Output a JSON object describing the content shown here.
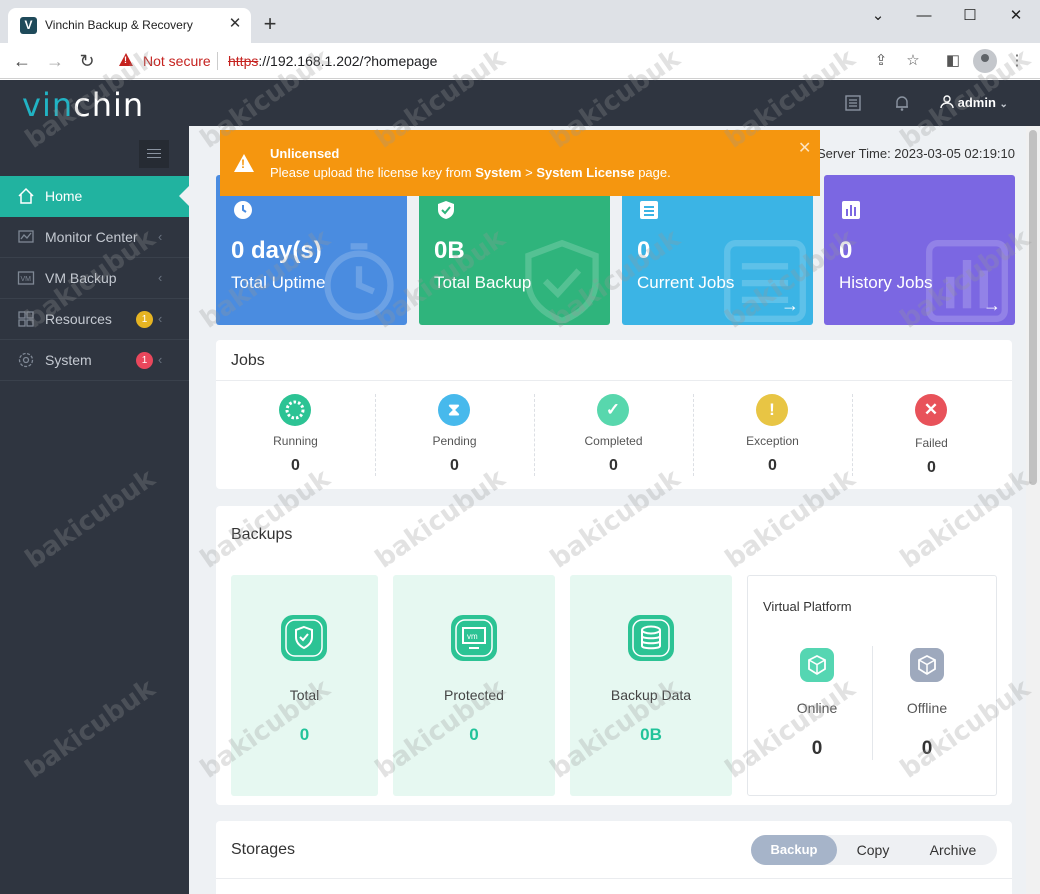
{
  "browser": {
    "tab_title": "Vinchin Backup & Recovery",
    "favicon_letter": "V",
    "security_label": "Not secure",
    "url_scheme": "https",
    "url_rest": "://192.168.1.202/?homepage"
  },
  "header": {
    "logo_accent": "vin",
    "logo_rest": "chin",
    "user": "admin"
  },
  "sidebar": {
    "items": [
      {
        "label": "Home",
        "icon": "home-icon",
        "active": true
      },
      {
        "label": "Monitor Center",
        "icon": "monitor-icon"
      },
      {
        "label": "VM Backup",
        "icon": "vm-icon"
      },
      {
        "label": "Resources",
        "icon": "resources-icon",
        "badge": "1",
        "badge_color": "#e6b422"
      },
      {
        "label": "System",
        "icon": "gear-icon",
        "badge": "1",
        "badge_color": "#e9475c"
      }
    ]
  },
  "banner": {
    "title": "Unlicensed",
    "msg_prefix": "Please upload the license key from ",
    "msg_path_1": "System",
    "msg_arrow": " > ",
    "msg_path_2": "System License",
    "msg_suffix": " page."
  },
  "server_time": "Server Time: 2023-03-05 02:19:10",
  "stats": [
    {
      "value": "0 day(s)",
      "label": "Total Uptime",
      "color": "#4a8ce0",
      "icon": "clock-icon"
    },
    {
      "value": "0B",
      "label": "Total Backup",
      "color": "#2fb47c",
      "icon": "shield-icon"
    },
    {
      "value": "0",
      "label": "Current Jobs",
      "color": "#3bb4e5",
      "icon": "list-icon"
    },
    {
      "value": "0",
      "label": "History Jobs",
      "color": "#7b67e2",
      "icon": "bar-chart-icon"
    }
  ],
  "jobs": {
    "title": "Jobs",
    "items": [
      {
        "label": "Running",
        "value": "0",
        "color": "#2cc394",
        "icon": "spinner-icon"
      },
      {
        "label": "Pending",
        "value": "0",
        "color": "#47b9ec",
        "icon": "hourglass-icon"
      },
      {
        "label": "Completed",
        "value": "0",
        "color": "#58d7ad",
        "icon": "check-icon"
      },
      {
        "label": "Exception",
        "value": "0",
        "color": "#e8c544",
        "icon": "exclamation-icon"
      },
      {
        "label": "Failed",
        "value": "0",
        "color": "#e8525a",
        "icon": "x-icon"
      }
    ]
  },
  "backups": {
    "title": "Backups",
    "items": [
      {
        "label": "Total",
        "value": "0",
        "icon": "shield-check-icon"
      },
      {
        "label": "Protected",
        "value": "0",
        "icon": "vm-protected-icon"
      },
      {
        "label": "Backup Data",
        "value": "0B",
        "icon": "database-icon"
      }
    ],
    "virtual_platform": {
      "title": "Virtual Platform",
      "online_label": "Online",
      "online_value": "0",
      "offline_label": "Offline",
      "offline_value": "0"
    }
  },
  "storages": {
    "title": "Storages",
    "tabs": [
      "Backup",
      "Copy",
      "Archive"
    ]
  },
  "watermark": "bakicubuk"
}
